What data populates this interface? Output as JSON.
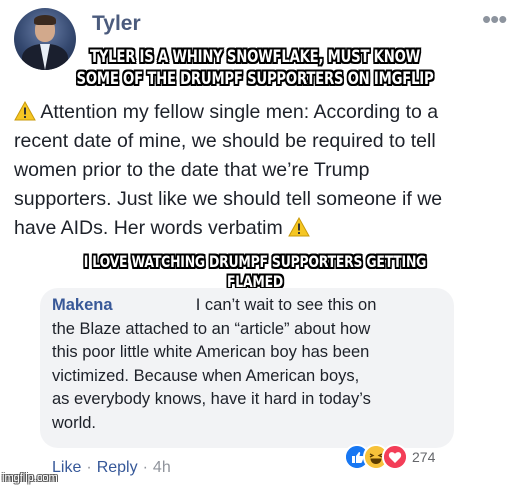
{
  "post": {
    "author": "Tyler",
    "more_icon": "more-dots-icon",
    "text_lines": [
      "Attention my fellow single men: According to a",
      "recent date of mine, we should be required to tell",
      "women prior to the date that we’re Trump",
      "supporters. Just like we should tell someone if we",
      "have AIDs. Her words verbatim"
    ],
    "warning_icon": "warning-icon"
  },
  "captions": {
    "top_line1": "TYLER IS A WHINY SNOWFLAKE, MUST KNOW",
    "top_line2": "SOME OF THE DRUMPF SUPPORTERS ON IMGFLIP",
    "middle": "I LOVE WATCHING DRUMPF SUPPORTERS GETTING FLAMED"
  },
  "comment": {
    "author": "Makena",
    "text_first": "I can’t wait to see this on",
    "text_rest": [
      "the Blaze attached to an “article” about how",
      "this poor little white American boy has been",
      "victimized. Because when American boys,",
      "as everybody knows, have it hard in today’s",
      "world."
    ],
    "reaction_count": "274",
    "reaction_icons": [
      "like-reaction-icon",
      "haha-reaction-icon",
      "love-reaction-icon"
    ],
    "actions": {
      "like": "Like",
      "reply": "Reply",
      "time": "4h",
      "separator": "·"
    }
  },
  "watermark": "imgflip.com",
  "colors": {
    "link_blue": "#385898",
    "name_gray_blue": "#4b5b7d",
    "comment_bg": "#f2f3f5",
    "warning_yellow": "#f5c623"
  }
}
